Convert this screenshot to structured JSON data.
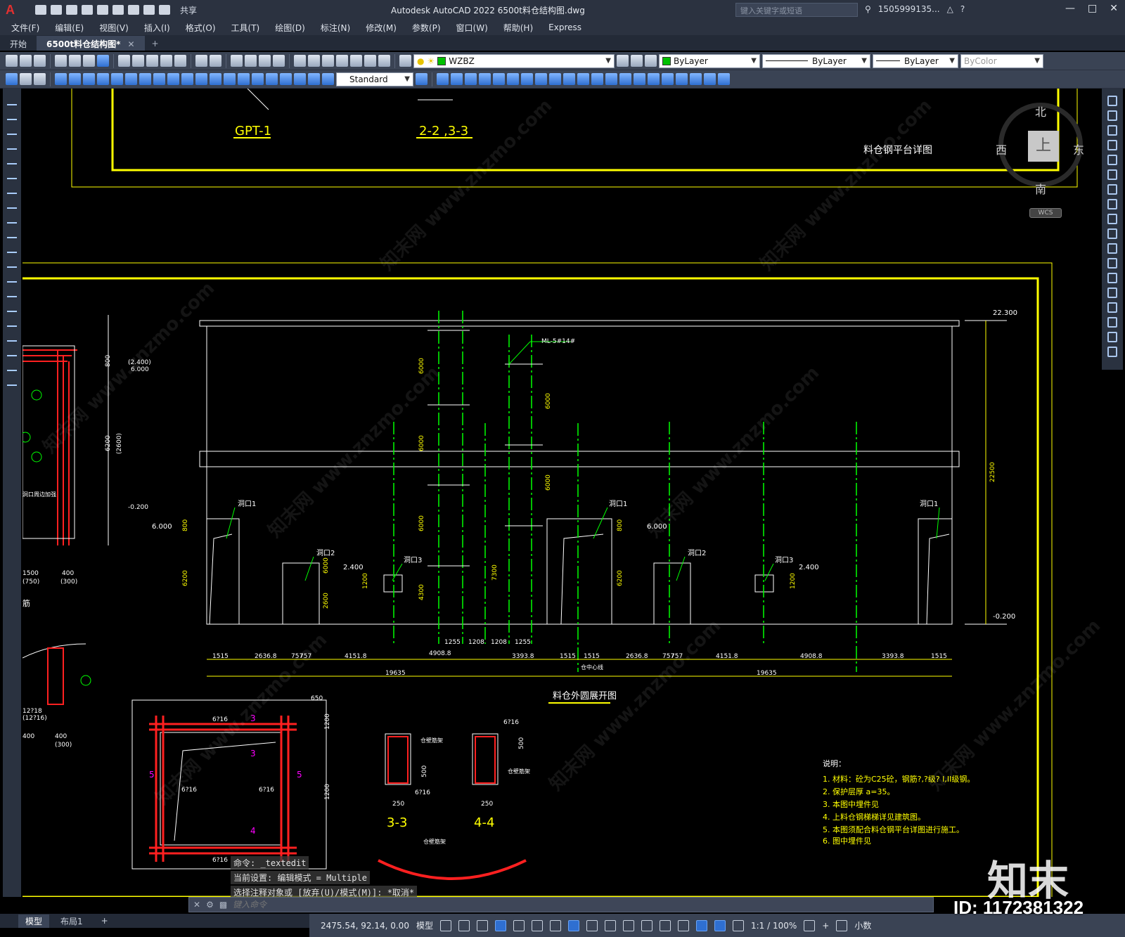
{
  "app": {
    "title": "Autodesk AutoCAD 2022    6500t料仓结构图.dwg",
    "share_label": "共享",
    "search_placeholder": "键入关键字或短语",
    "user": "1505999135...",
    "command_placeholder": "键入命令"
  },
  "menu": [
    "文件(F)",
    "编辑(E)",
    "视图(V)",
    "插入(I)",
    "格式(O)",
    "工具(T)",
    "绘图(D)",
    "标注(N)",
    "修改(M)",
    "参数(P)",
    "窗口(W)",
    "帮助(H)",
    "Express"
  ],
  "tabs": [
    {
      "label": "开始"
    },
    {
      "label": "6500t料仓结构图*"
    }
  ],
  "toolbar": {
    "layer": "WZBZ",
    "color": "ByLayer",
    "linetype": "ByLayer",
    "lineweight": "ByLayer",
    "plotstyle": "ByColor",
    "textstyle": "Standard"
  },
  "viewcube": {
    "north": "北",
    "south": "南",
    "east": "东",
    "west": "西",
    "top": "上",
    "wcs": "WCS"
  },
  "command_history": [
    "命令: _textedit",
    "当前设置: 编辑模式 = Multiple",
    "选择注释对象或 [放弃(U)/模式(M)]: *取消*"
  ],
  "layout_tabs": [
    "模型",
    "布局1"
  ],
  "status": {
    "coords": "2475.54, 92.14, 0.00",
    "space": "模型",
    "scale": "1:1 / 100%",
    "units": "小数"
  },
  "drawing": {
    "top_labels": [
      "GPT-1",
      "2-2 ,3-3",
      "料仓钢平台详图"
    ],
    "elevation_title": "料仓外圆展开图",
    "center_line": "仓中心线",
    "elevations": [
      "22.300",
      "-0.200",
      "6.000",
      "2.400",
      "(2.400)",
      "6.000",
      "-0.200"
    ],
    "openings": [
      "洞口1",
      "洞口2",
      "洞口3",
      "洞口1",
      "洞口2",
      "洞口3",
      "洞口1"
    ],
    "ml_label": "ML-5#14#",
    "dims_bottom": [
      "1515",
      "2636.8",
      "757",
      "757",
      "4151.8",
      "4908.8",
      "1255",
      "1208",
      "1208",
      "1255",
      "3393.8",
      "1515",
      "1515",
      "2636.8",
      "757",
      "757",
      "4151.8",
      "4908.8",
      "3393.8",
      "1515"
    ],
    "dims_total": [
      "19635",
      "19635"
    ],
    "dims_vertical": [
      "6000",
      "6000",
      "6000",
      "6000",
      "4300",
      "7300",
      "6000",
      "6000",
      "800",
      "6200",
      "800",
      "6200",
      "1200",
      "2600",
      "1200",
      "22500"
    ],
    "sections": [
      "3-3",
      "4-4"
    ],
    "section_labels": [
      "250",
      "250",
      "500",
      "500",
      "6?16",
      "6?16",
      "仓壁筋架",
      "仓壁筋架"
    ],
    "left_labels": [
      "800",
      "6200",
      "(2600)",
      "(2.400)",
      "6.000",
      "-0.200",
      "1500",
      "400",
      "(750)",
      "(300)",
      "洞口周边加强",
      "筋",
      "12?18",
      "(12?16)",
      "400",
      "(300)"
    ],
    "frame_labels": [
      "650",
      "1200",
      "1200",
      "6?16",
      "6?16",
      "6?16",
      "6?16",
      "3",
      "3",
      "4",
      "5",
      "5"
    ],
    "notes_title": "说明：",
    "notes": [
      "1. 材料：砼为C25砼，钢筋?,?级? I,II级钢。",
      "2. 保护层厚 a=35。",
      "3. 本图中埋件见",
      "4. 上料仓钢梯梯详见建筑图。",
      "5. 本图须配合料仓钢平台详图进行施工。",
      "6. 图中埋件见"
    ],
    "bottom_label": "仓壁筋架"
  },
  "watermark": {
    "brand": "知末",
    "id": "ID: 1172381322",
    "text": "知末网 www.znzmo.com"
  },
  "colors": {
    "chrome": "#2b3240",
    "toolbar": "#3a4354",
    "canvas": "#000000",
    "yellow": "#ffff00",
    "green": "#00ff00",
    "white": "#ffffff",
    "red": "#ff2020",
    "magenta": "#ff00ff"
  }
}
